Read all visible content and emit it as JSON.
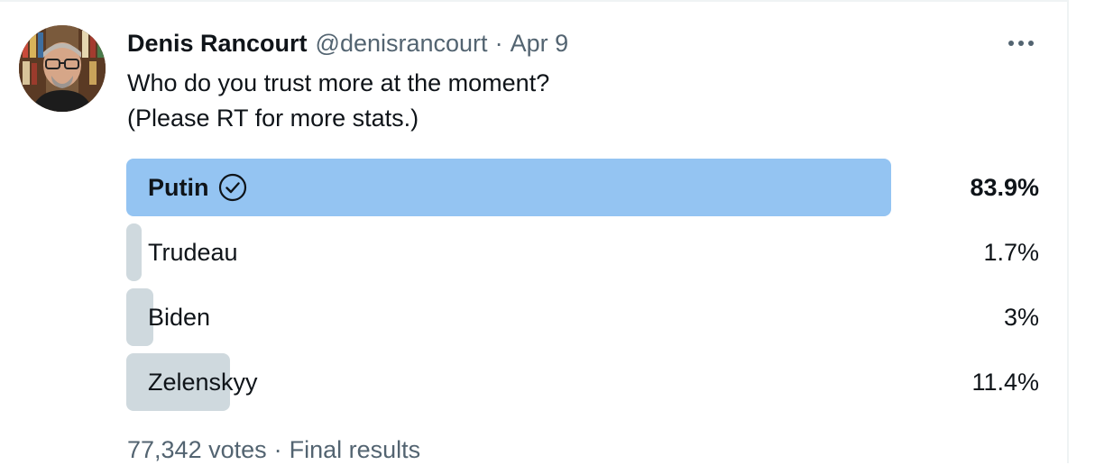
{
  "tweet": {
    "author_name": "Denis Rancourt",
    "handle": "@denisrancourt",
    "separator": "·",
    "date": "Apr 9",
    "more_icon": "more-horizontal-icon",
    "text_lines": [
      "Who do you trust more at the moment?",
      "(Please RT for more stats.)"
    ]
  },
  "poll": {
    "options": [
      {
        "label": "Putin",
        "percent_text": "83.9%",
        "percent_value": 83.9,
        "winner": true
      },
      {
        "label": "Trudeau",
        "percent_text": "1.7%",
        "percent_value": 1.7,
        "winner": false
      },
      {
        "label": "Biden",
        "percent_text": "3%",
        "percent_value": 3,
        "winner": false
      },
      {
        "label": "Zelenskyy",
        "percent_text": "11.4%",
        "percent_value": 11.4,
        "winner": false
      }
    ],
    "winner_icon": "check-circle-icon",
    "votes": "77,342 votes",
    "footer_separator": "·",
    "status": "Final results"
  },
  "colors": {
    "winner_bar": "#94c4f2",
    "other_bar": "#cfd9de",
    "secondary_text": "#536471",
    "primary_text": "#0f1419"
  }
}
